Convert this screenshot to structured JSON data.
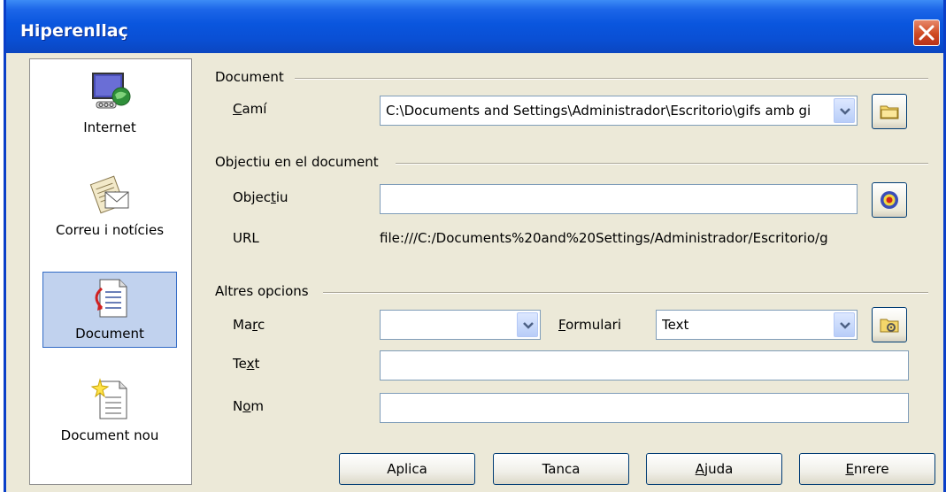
{
  "window": {
    "title": "Hiperenllaç"
  },
  "categories": [
    {
      "label": "Internet",
      "icon": "internet-globe-icon",
      "selected": false
    },
    {
      "label": "Correu i notícies",
      "icon": "mail-news-icon",
      "selected": false
    },
    {
      "label": "Document",
      "icon": "document-link-icon",
      "selected": true
    },
    {
      "label": "Document nou",
      "icon": "new-document-icon",
      "selected": false
    }
  ],
  "document_group": {
    "title": "Document",
    "path_label_pre": "",
    "path_label_u": "C",
    "path_label_post": "amí",
    "path_value": "C:\\Documents and Settings\\Administrador\\Escritorio\\gifs amb gi"
  },
  "target_group": {
    "title": "Objectiu en el document",
    "target_label_pre": "Objec",
    "target_label_u": "t",
    "target_label_post": "iu",
    "target_value": "",
    "url_label": "URL",
    "url_value": "file:///C:/Documents%20and%20Settings/Administrador/Escritorio/g"
  },
  "options_group": {
    "title": "Altres opcions",
    "frame_label_pre": "Ma",
    "frame_label_u": "r",
    "frame_label_post": "c",
    "frame_value": "",
    "form_label_pre": "",
    "form_label_u": "F",
    "form_label_post": "ormulari",
    "form_value": "Text",
    "text_label_pre": "Te",
    "text_label_u": "x",
    "text_label_post": "t",
    "text_value": "",
    "name_label_pre": "N",
    "name_label_u": "o",
    "name_label_post": "m",
    "name_value": ""
  },
  "buttons": {
    "apply": "Aplica",
    "close": "Tanca",
    "help_u": "A",
    "help_post": "juda",
    "back_u": "E",
    "back_post": "nrere"
  },
  "colors": {
    "titlebar": "#0a56de",
    "selection": "#c1d2ee",
    "dialog_bg": "#ece9d8"
  }
}
